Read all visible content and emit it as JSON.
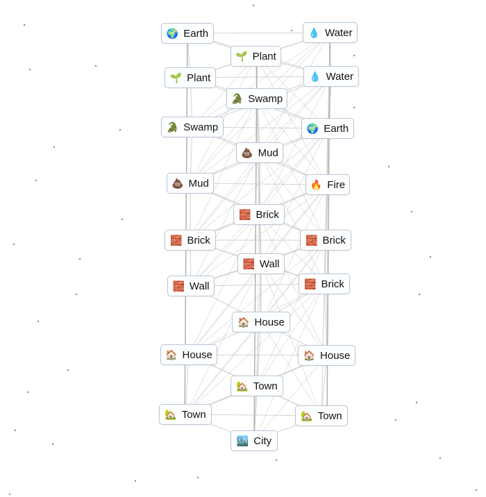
{
  "elements": [
    {
      "label": "Earth",
      "emoji": "🌍"
    },
    {
      "label": "Water",
      "emoji": "💧"
    },
    {
      "label": "Plant",
      "emoji": "🌱"
    },
    {
      "label": "Plant",
      "emoji": "🌱"
    },
    {
      "label": "Water",
      "emoji": "💧"
    },
    {
      "label": "Swamp",
      "emoji": "🐊"
    },
    {
      "label": "Swamp",
      "emoji": "🐊"
    },
    {
      "label": "Earth",
      "emoji": "🌍"
    },
    {
      "label": "Mud",
      "emoji": "💩"
    },
    {
      "label": "Mud",
      "emoji": "💩"
    },
    {
      "label": "Fire",
      "emoji": "🔥"
    },
    {
      "label": "Brick",
      "emoji": "🧱"
    },
    {
      "label": "Brick",
      "emoji": "🧱"
    },
    {
      "label": "Brick",
      "emoji": "🧱"
    },
    {
      "label": "Wall",
      "emoji": "🧱"
    },
    {
      "label": "Wall",
      "emoji": "🧱"
    },
    {
      "label": "Brick",
      "emoji": "🧱"
    },
    {
      "label": "House",
      "emoji": "🏠"
    },
    {
      "label": "House",
      "emoji": "🏠"
    },
    {
      "label": "House",
      "emoji": "🏠"
    },
    {
      "label": "Town",
      "emoji": "🏡"
    },
    {
      "label": "Town",
      "emoji": "🏡"
    },
    {
      "label": "Town",
      "emoji": "🏡"
    },
    {
      "label": "City",
      "emoji": "🏙️"
    }
  ],
  "colors": {
    "edge": "#c8c8c8",
    "border": "#b9c6d6",
    "star": "#888888"
  }
}
